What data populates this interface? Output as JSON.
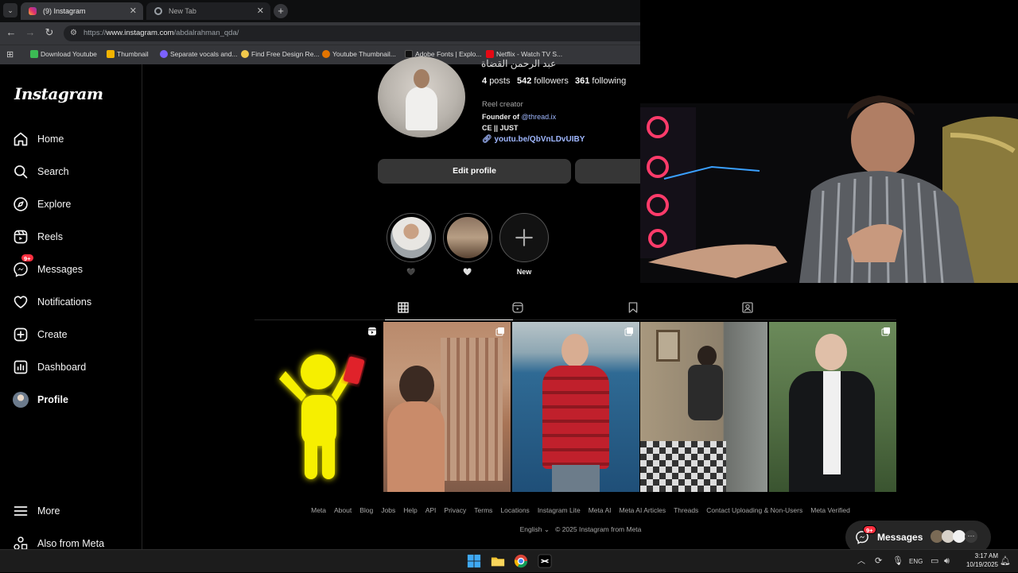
{
  "browser": {
    "tabs": [
      {
        "label": "(9) Instagram",
        "active": true
      },
      {
        "label": "New Tab",
        "active": false
      }
    ],
    "url_scheme": "https://",
    "url_host": "www.instagram.com",
    "url_path": "/abdalrahman_qda/",
    "bookmarks": [
      {
        "label": "Download Youtube",
        "color": "#3cba54"
      },
      {
        "label": "Thumbnail",
        "color": "#f4b400"
      },
      {
        "label": "Separate vocals and...",
        "color": "#7b61ff"
      },
      {
        "label": "Find Free Design Re...",
        "color": "#f2c94c"
      },
      {
        "label": "Youtube Thumbnail...",
        "color": "#e37400"
      },
      {
        "label": "Adobe Fonts | Explo...",
        "color": "#111111"
      },
      {
        "label": "Netflix - Watch TV S...",
        "color": "#e50914"
      }
    ]
  },
  "sidebar": {
    "logo": "Instagram",
    "items": [
      {
        "label": "Home",
        "icon": "home-icon"
      },
      {
        "label": "Search",
        "icon": "search-icon"
      },
      {
        "label": "Explore",
        "icon": "compass-icon"
      },
      {
        "label": "Reels",
        "icon": "reels-icon"
      },
      {
        "label": "Messages",
        "icon": "messenger-icon",
        "badge": "9+"
      },
      {
        "label": "Notifications",
        "icon": "heart-icon"
      },
      {
        "label": "Create",
        "icon": "plus-square-icon"
      },
      {
        "label": "Dashboard",
        "icon": "dashboard-icon"
      },
      {
        "label": "Profile",
        "icon": "avatar"
      }
    ],
    "more": "More",
    "also_from_meta": "Also from Meta"
  },
  "profile": {
    "name": "عبد الرحمن القضاة",
    "posts_count": "4",
    "posts_label": "posts",
    "followers_count": "542",
    "followers_label": "followers",
    "following_count": "361",
    "following_label": "following",
    "category": "Reel creator",
    "bio_line1_prefix": "Founder of",
    "bio_line1_mention": "@thread.ix",
    "bio_line2": "CE || JUST",
    "bio_link": "youtu.be/QbVnLDvUIBY",
    "edit_profile": "Edit profile",
    "highlights": [
      {
        "label": "🖤"
      },
      {
        "label": "🤍"
      },
      {
        "label": "New"
      }
    ]
  },
  "footer": {
    "links": [
      "Meta",
      "About",
      "Blog",
      "Jobs",
      "Help",
      "API",
      "Privacy",
      "Terms",
      "Locations",
      "Instagram Lite",
      "Meta AI",
      "Meta AI Articles",
      "Threads",
      "Contact Uploading & Non-Users",
      "Meta Verified"
    ],
    "language": "English",
    "copyright": "© 2025 Instagram from Meta"
  },
  "messages_pill": {
    "label": "Messages",
    "badge": "9+"
  },
  "taskbar": {
    "lang": "ENG",
    "time": "3:17 AM",
    "date": "10/19/2025"
  }
}
